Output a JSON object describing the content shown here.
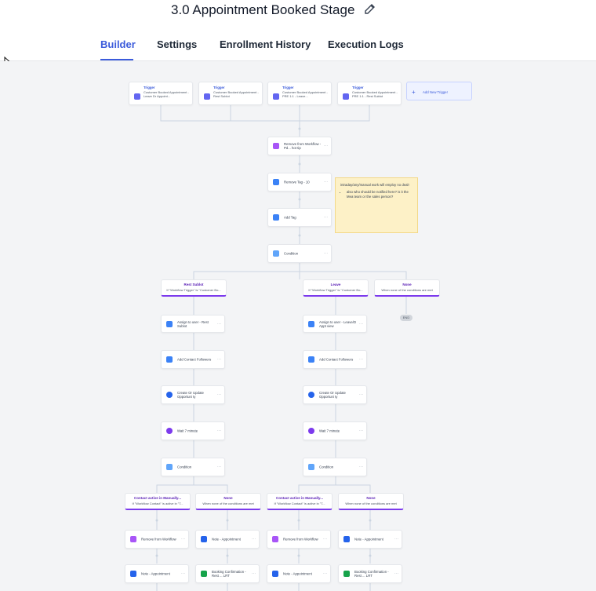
{
  "header": {
    "title": "3.0 Appointment Booked Stage"
  },
  "tabs": [
    {
      "label": "Builder",
      "active": true
    },
    {
      "label": "Settings"
    },
    {
      "label": "Enrollment History"
    },
    {
      "label": "Execution Logs"
    }
  ],
  "triggers": [
    {
      "heading": "Trigger",
      "text": "Customer Booked Appointment - Leave Dr Appoint..."
    },
    {
      "heading": "Trigger",
      "text": "Customer Booked Appointment - Rest Sublot"
    },
    {
      "heading": "Trigger",
      "text": "Customer Booked Appointment - PRE 1:1 - Leave..."
    },
    {
      "heading": "Trigger",
      "text": "Customer Booked Appointment - PRE 1:1 - Rest Sublot"
    }
  ],
  "add_trigger": "Add New Trigger",
  "main_actions": [
    "Remove from Workflow - Pd... hot tip",
    "Remove Tag - 10",
    "Add Tag",
    "Condition"
  ],
  "note": {
    "text": "intraday/any/manual work will employ no deal!",
    "bullets": [
      "also who should be notified here? is it the Mea team or the sales person?"
    ]
  },
  "branches_top": [
    {
      "name": "Rest Sublot",
      "desc": "If \"Workflow Trigger\" is \"Customer Bo..."
    },
    {
      "name": "Leave",
      "desc": "If \"Workflow Trigger\" is \"Customer Bo..."
    },
    {
      "name": "None",
      "desc": "When none of the conditions are met"
    }
  ],
  "end_label": "END",
  "left_column": [
    "Assign to user - Rest Sublot",
    "Add Contact Followers",
    "Create Or Update Opportuni ty",
    "Wait 7 minute",
    "Condition"
  ],
  "right_column": [
    "Assign to user - Leave/D Appt view",
    "Add Contact Followers",
    "Create Or Update Opportuni ty",
    "Wait 7 minute",
    "Condition"
  ],
  "branches_bottom": [
    {
      "name": "Contact active in Manually...",
      "desc": "If \"Workflow Contact\" is active in \"T..."
    },
    {
      "name": "None",
      "desc": "When none of the conditions are met"
    },
    {
      "name": "Contact active in Manually...",
      "desc": "If \"Workflow Contact\" is active in \"T..."
    },
    {
      "name": "None",
      "desc": "When none of the conditions are met"
    }
  ],
  "bottom_row1": [
    "Remove from Workflow",
    "Note - Appointment",
    "Remove from Workflow",
    "Note - Appointment"
  ],
  "bottom_row2": [
    "Note - Appointment",
    "Booking Confirmation - Rest ... LRT",
    "Note - Appointment",
    "Booking Confirmation - Rest ... LRT"
  ],
  "colors": {
    "accent": "#3b5bdb",
    "branch": "#7c3aed",
    "note_bg": "#fdf1c7"
  }
}
